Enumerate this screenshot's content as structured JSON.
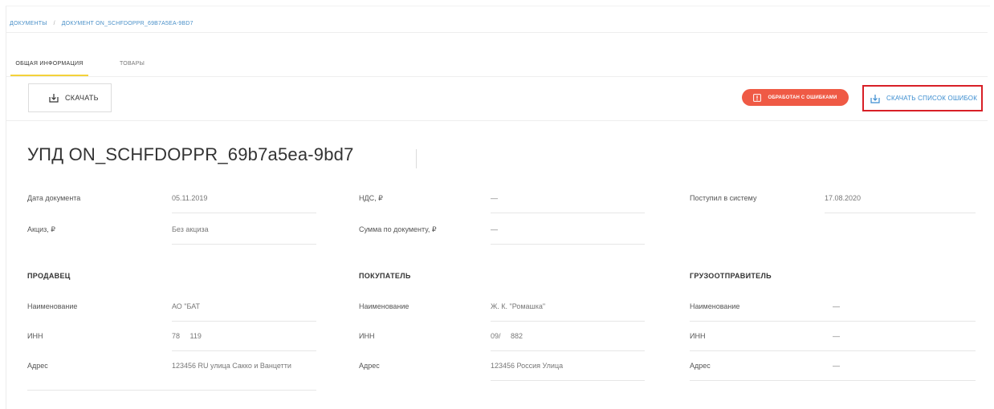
{
  "breadcrumb": {
    "root": "ДОКУМЕНТЫ",
    "separator": "/",
    "current": "ДОКУМЕНТ ON_SCHFDOPPR_69b7a5ea-9bd7"
  },
  "tabs": [
    {
      "label": "ОБЩАЯ ИНФОРМАЦИЯ",
      "active": true
    },
    {
      "label": "ТОВАРЫ",
      "active": false
    }
  ],
  "toolbar": {
    "download_label": "СКАЧАТЬ",
    "status_label": "ОБРАБОТАН С ОШИБКАМИ",
    "download_errors_label": "СКАЧАТЬ СПИСОК ОШИБОК"
  },
  "title": "УПД ON_SCHFDOPPR_69b7a5ea-9bd7",
  "info": {
    "doc_date_label": "Дата документа",
    "doc_date_value": "05.11.2019",
    "vat_label": "НДС, ₽",
    "vat_value": "—",
    "received_label": "Поступил в систему",
    "received_value": "17.08.2020",
    "excise_label": "Акциз, ₽",
    "excise_value": "Без акциза",
    "sum_label": "Сумма по документу, ₽",
    "sum_value": "—"
  },
  "seller": {
    "title": "ПРОДАВЕЦ",
    "name_label": "Наименование",
    "name_value": "АО \"БАТ",
    "inn_label": "ИНН",
    "inn_value": "78     119",
    "address_label": "Адрес",
    "address_value": "123456 RU улица Сакко и Ванцетти"
  },
  "buyer": {
    "title": "ПОКУПАТЕЛЬ",
    "name_label": "Наименование",
    "name_value": "Ж. К. \"Ромашка\"",
    "inn_label": "ИНН",
    "inn_value": "09/     882",
    "address_label": "Адрес",
    "address_value": "123456 Россия Улица"
  },
  "shipper": {
    "title": "ГРУЗООТПРАВИТЕЛЬ",
    "name_label": "Наименование",
    "name_value": "—",
    "inn_label": "ИНН",
    "inn_value": "—",
    "address_label": "Адрес",
    "address_value": "—"
  },
  "colors": {
    "accent_tab": "#f4d23a",
    "status_error": "#ef5a45",
    "link": "#3b8dd0",
    "highlight_border": "#d81f26"
  },
  "icons": {
    "download": "download-icon",
    "alert": "alert-icon"
  }
}
